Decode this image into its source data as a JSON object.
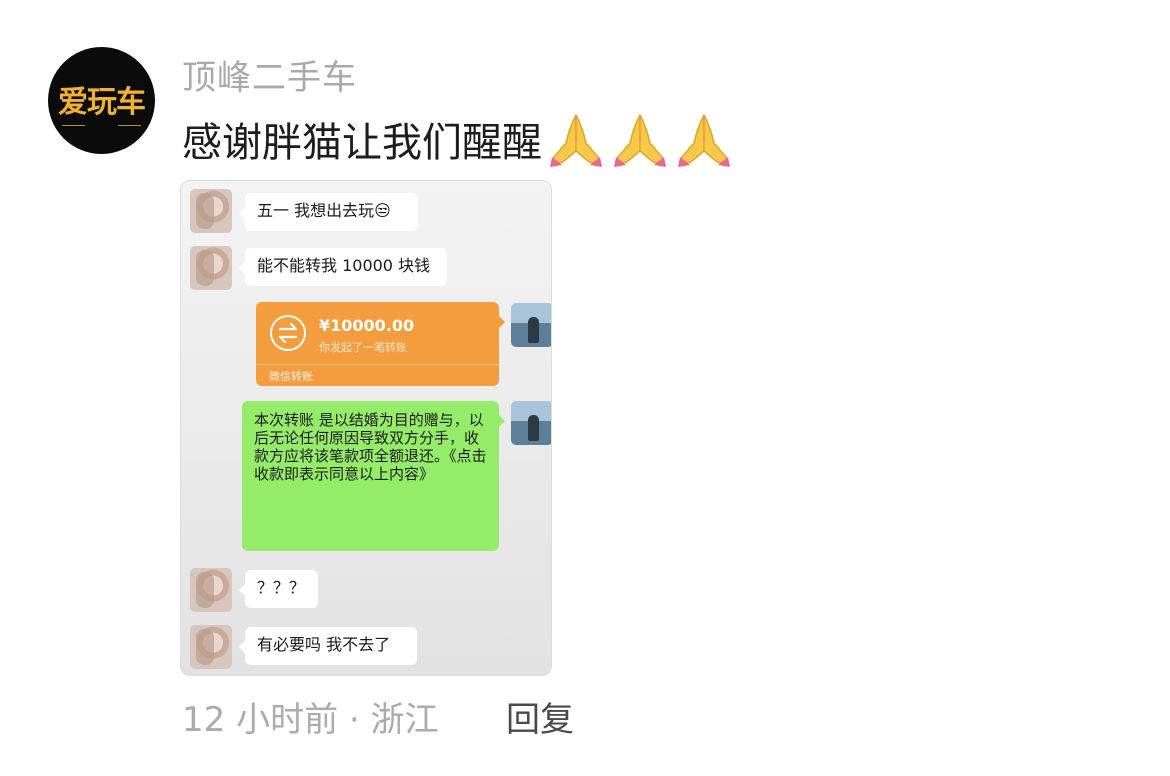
{
  "post": {
    "avatar_logo_text": "爱玩车",
    "username": "顶峰二手车",
    "comment_text": "感谢胖猫让我们醒醒",
    "emoji": "folded-hands",
    "emoji_count": 3,
    "time_location": "12 小时前 · 浙江",
    "reply_label": "回复"
  },
  "chat": {
    "messages": [
      {
        "sender": "her",
        "text": "五一 我想出去玩😒"
      },
      {
        "sender": "her",
        "text": "能不能转我 10000 块钱"
      },
      {
        "sender": "me",
        "type": "transfer",
        "amount": "¥10000.00",
        "desc": "你发起了一笔转账",
        "footer": "微信转账"
      },
      {
        "sender": "me",
        "text": "本次转账 是以结婚为目的赠与，以后无论任何原因导致双方分手，收款方应将该笔款项全额退还。《点击收款即表示同意以上内容》"
      },
      {
        "sender": "her",
        "text": "？？？"
      },
      {
        "sender": "her",
        "text": "有必要吗 我不去了"
      }
    ]
  },
  "colors": {
    "transfer_orange": "#f49d3f",
    "bubble_green": "#95ec69",
    "username_gray": "#a9a9a9"
  }
}
